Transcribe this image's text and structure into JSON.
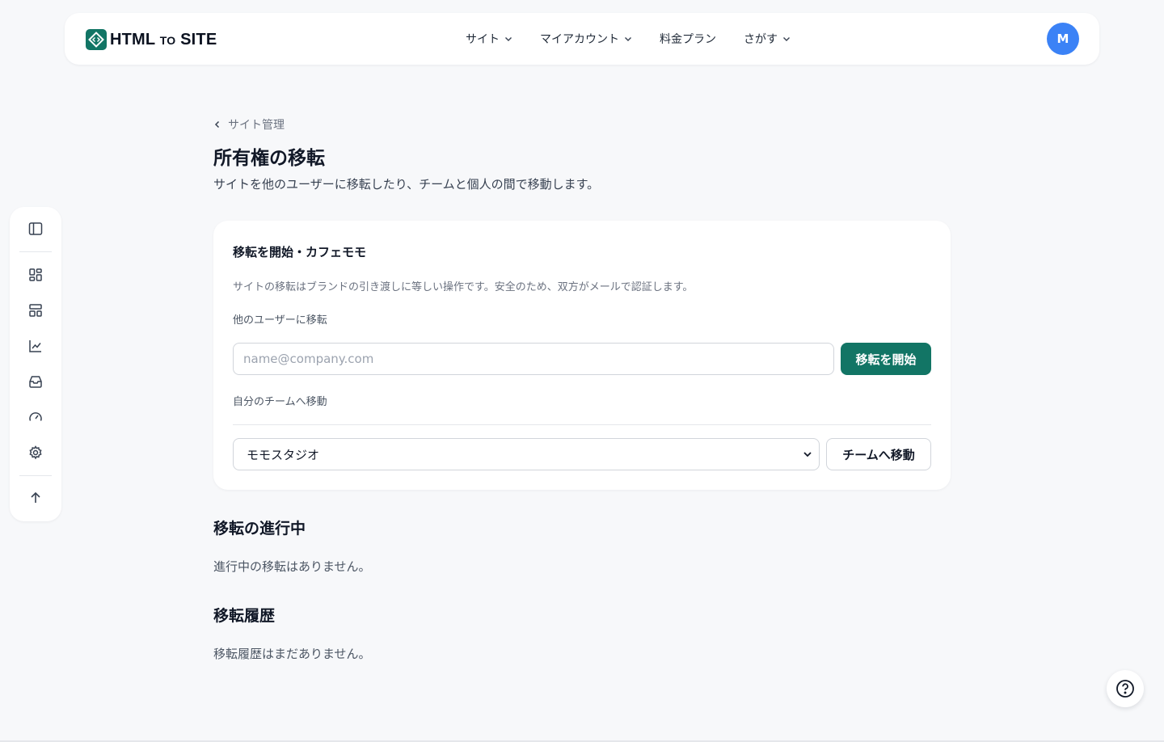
{
  "brand": {
    "logo_main": "HTML",
    "logo_small": "TO",
    "logo_end": "SITE",
    "accent": "#127565"
  },
  "nav": {
    "items": [
      {
        "label": "サイト",
        "dropdown": true
      },
      {
        "label": "マイアカウント",
        "dropdown": true
      },
      {
        "label": "料金プラン",
        "dropdown": false
      },
      {
        "label": "さがす",
        "dropdown": true
      }
    ]
  },
  "user": {
    "initial": "M",
    "avatar_color": "#3b82f6"
  },
  "sidebar": {
    "items": [
      "panel-toggle-icon",
      "dashboard-icon",
      "layout-icon",
      "analytics-icon",
      "inbox-icon",
      "speed-icon",
      "settings-icon",
      "scroll-top-icon"
    ]
  },
  "page": {
    "back_label": "サイト管理",
    "title": "所有権の移転",
    "subtitle": "サイトを他のユーザーに移転したり、チームと個人の間で移動します。"
  },
  "transfer_card": {
    "title": "移転を開始・カフェモモ",
    "description": "サイトの移転はブランドの引き渡しに等しい操作です。安全のため、双方がメールで認証します。",
    "user_label": "他のユーザーに移転",
    "email_placeholder": "name@company.com",
    "email_value": "",
    "start_button": "移転を開始",
    "team_label": "自分のチームへ移動",
    "team_selected": "モモスタジオ",
    "team_button": "チームへ移動"
  },
  "in_progress": {
    "title": "移転の進行中",
    "empty": "進行中の移転はありません。"
  },
  "history": {
    "title": "移転履歴",
    "empty": "移転履歴はまだありません。"
  }
}
